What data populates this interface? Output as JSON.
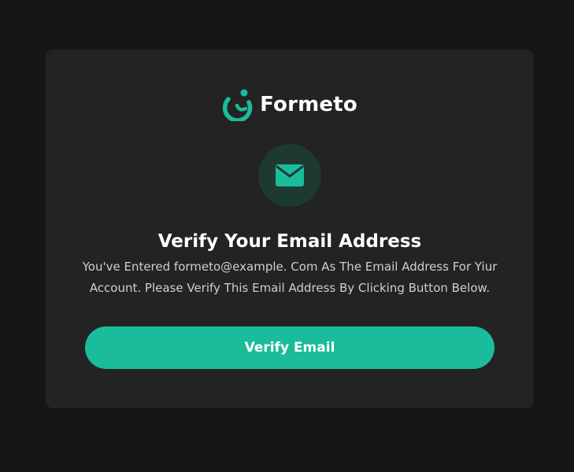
{
  "brand": {
    "name": "Formeto",
    "accent_color": "#1bbc9b",
    "logo_icon": "formeto-logo-icon"
  },
  "mail_badge": {
    "icon": "envelope-icon"
  },
  "content": {
    "title": "Verify Your Email Address",
    "description": "You've Entered formeto@example. Com As The Email Address For Yiur Account. Please Verify This Email Address By Clicking Button Below."
  },
  "actions": {
    "verify_label": "Verify Email"
  }
}
